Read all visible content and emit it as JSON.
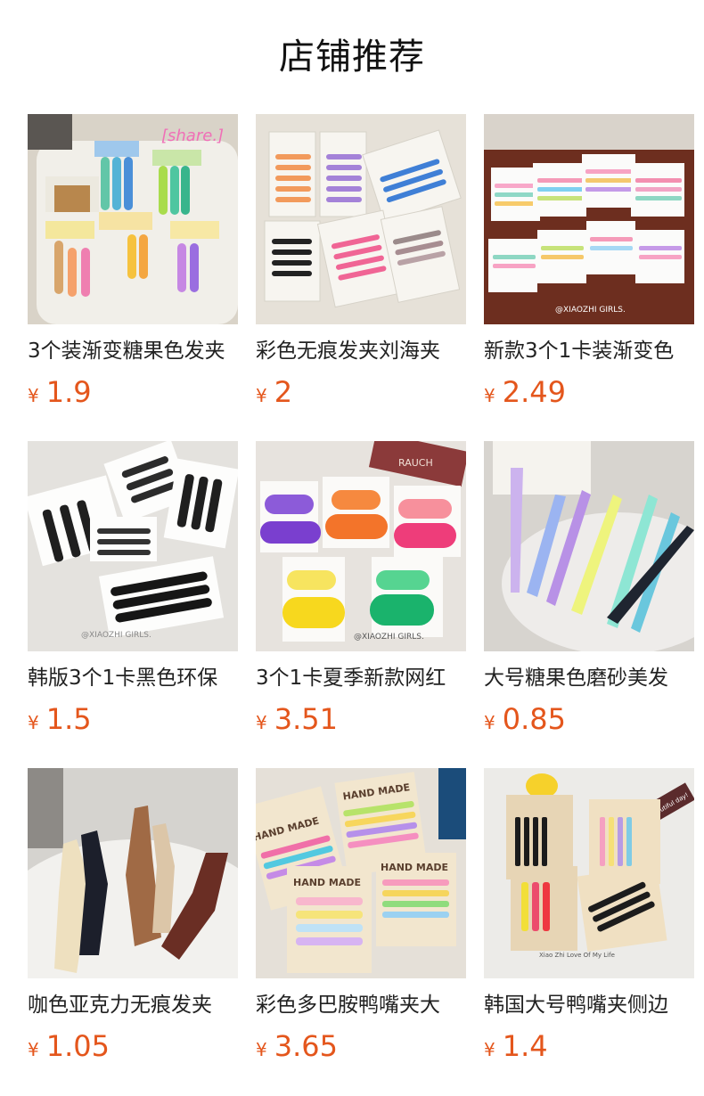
{
  "header": {
    "title": "店铺推荐"
  },
  "currency_symbol": "¥",
  "products": [
    {
      "name": "3个装渐变糖果色发夹",
      "price": "1.9",
      "icon": "hair-clip-bag-photo"
    },
    {
      "name": "彩色无痕发夹刘海夹",
      "price": "2",
      "icon": "hair-clip-card-photo"
    },
    {
      "name": "新款3个1卡装渐变色",
      "price": "2.49",
      "icon": "gradient-clip-photo"
    },
    {
      "name": "韩版3个1卡黑色环保",
      "price": "1.5",
      "icon": "black-clip-photo"
    },
    {
      "name": "3个1卡夏季新款网红",
      "price": "3.51",
      "icon": "oval-clip-photo"
    },
    {
      "name": "大号糖果色磨砂美发",
      "price": "0.85",
      "icon": "matte-clip-photo"
    },
    {
      "name": "咖色亚克力无痕发夹",
      "price": "1.05",
      "icon": "brown-clip-photo"
    },
    {
      "name": "彩色多巴胺鸭嘴夹大",
      "price": "3.65",
      "icon": "duckbill-clip-photo"
    },
    {
      "name": "韩国大号鸭嘴夹侧边",
      "price": "1.4",
      "icon": "korean-clip-photo"
    }
  ],
  "photo_text": {
    "share": "[share.]",
    "brand": "@XIAOZHI GIRLS.",
    "hand_made": "HAND MADE",
    "rauch": "RAUCH",
    "xiao_zhi": "Xiao Zhi Love Of My Life",
    "beautiful": "beautiful day!"
  },
  "colors": {
    "price": "#e4561c",
    "title": "#111111",
    "text": "#222222"
  }
}
